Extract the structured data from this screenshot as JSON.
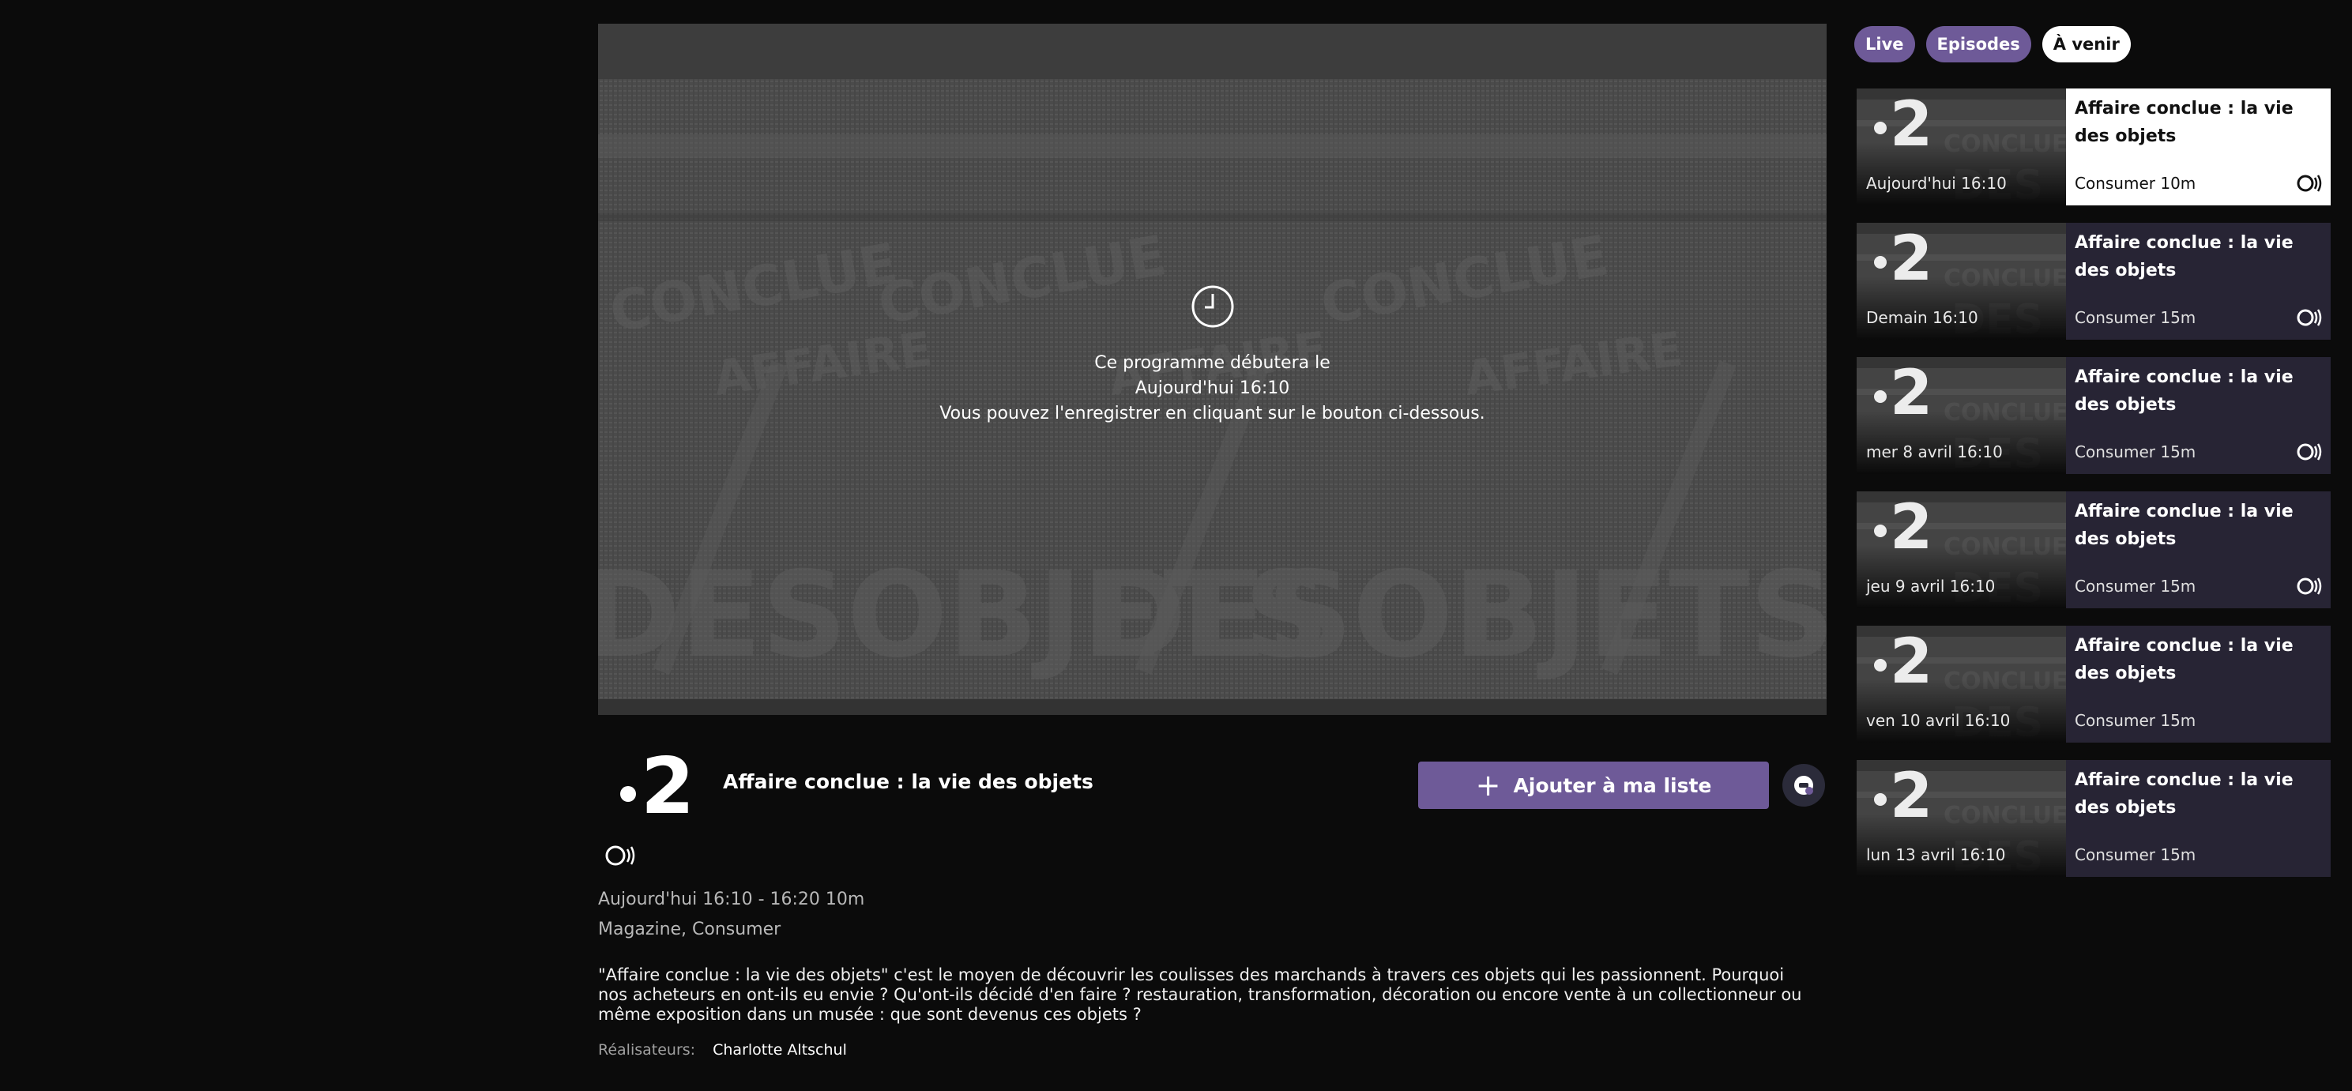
{
  "player": {
    "message_line1": "Ce programme débutera le",
    "message_line2": "Aujourd'hui 16:10",
    "message_line3": "Vous pouvez l'enregistrer en cliquant sur le bouton ci-dessous.",
    "icon": "clock-icon"
  },
  "channel": {
    "logo_text": "2"
  },
  "program": {
    "title": "Affaire conclue : la vie des objets",
    "add_to_list_label": "Ajouter à ma liste",
    "schedule": "Aujourd'hui 16:10 - 16:20 10m",
    "genres": "Magazine, Consumer",
    "description": "\"Affaire conclue : la vie des objets\" c'est le moyen de découvrir les coulisses des marchands à travers ces objets qui les passionnent. Pourquoi nos acheteurs en ont-ils eu envie ? Qu'ont-ils décidé d'en faire ? restauration, transformation, décoration ou encore vente à un collectionneur ou même exposition dans un musée : que sont devenus ces objets ?",
    "credits_label": "Réalisateurs:",
    "credits_value": "Charlotte Altschul"
  },
  "tabs": [
    {
      "label": "Live"
    },
    {
      "label": "Episodes"
    },
    {
      "label": "À venir"
    }
  ],
  "episodes": [
    {
      "title": "Affaire conclue : la vie des objets",
      "when": "Aujourd'hui 16:10",
      "genre": "Consumer 10m",
      "audio_description": true,
      "active": true
    },
    {
      "title": "Affaire conclue : la vie des objets",
      "when": "Demain 16:10",
      "genre": "Consumer 15m",
      "audio_description": true,
      "active": false
    },
    {
      "title": "Affaire conclue : la vie des objets",
      "when": "mer 8 avril 16:10",
      "genre": "Consumer 15m",
      "audio_description": true,
      "active": false
    },
    {
      "title": "Affaire conclue : la vie des objets",
      "when": "jeu 9 avril 16:10",
      "genre": "Consumer 15m",
      "audio_description": true,
      "active": false
    },
    {
      "title": "Affaire conclue : la vie des objets",
      "when": "ven 10 avril 16:10",
      "genre": "Consumer 15m",
      "audio_description": false,
      "active": false
    },
    {
      "title": "Affaire conclue : la vie des objets",
      "when": "lun 13 avril 16:10",
      "genre": "Consumer 15m",
      "audio_description": false,
      "active": false
    }
  ],
  "colors": {
    "accent": "#6e5a98",
    "background": "#0b0b0b",
    "card": "#272434"
  }
}
